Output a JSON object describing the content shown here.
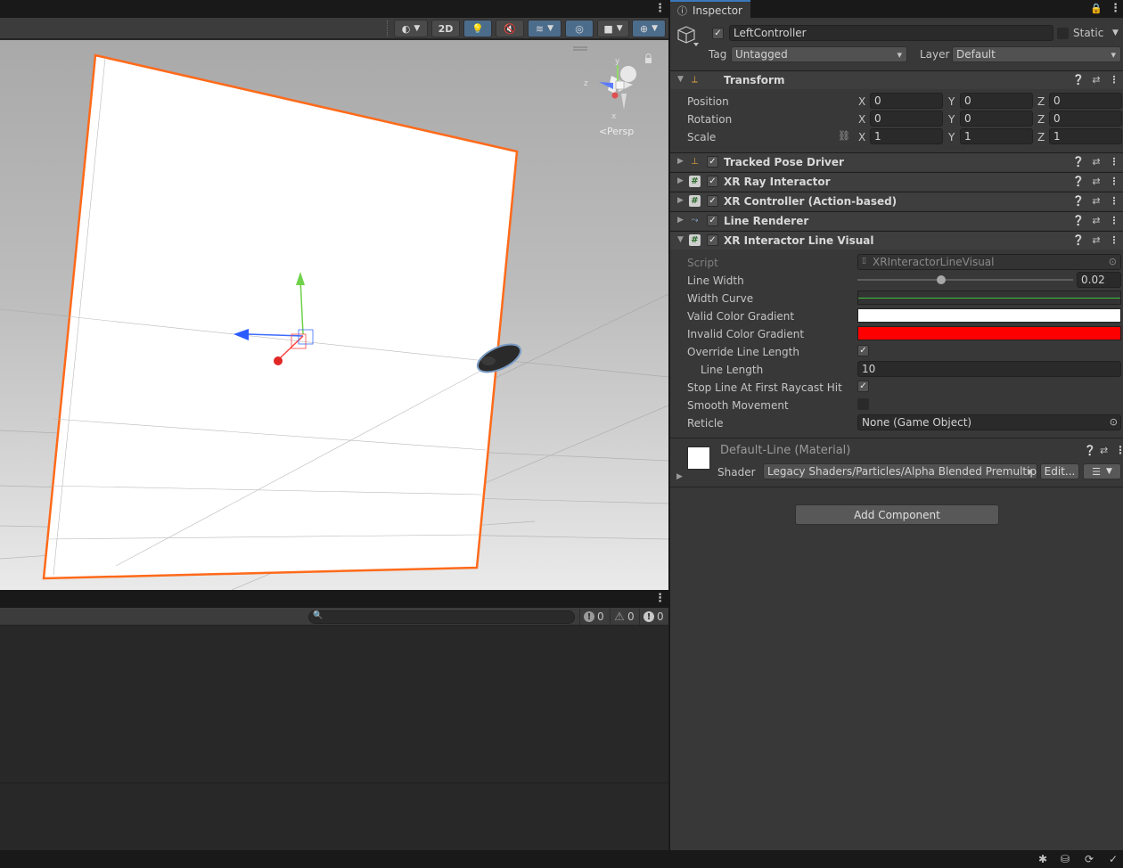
{
  "scene": {
    "toolbar": {
      "mode_2d": "2D",
      "persp_label": "Persp",
      "gizmo_axes": {
        "x": "x",
        "y": "y",
        "z": "z"
      }
    }
  },
  "console": {
    "search_placeholder": "",
    "counts": {
      "info": "0",
      "warning": "0",
      "error": "0"
    }
  },
  "inspector": {
    "tab_label": "Inspector",
    "object": {
      "name": "LeftController",
      "static_label": "Static",
      "tag_label": "Tag",
      "tag_value": "Untagged",
      "layer_label": "Layer",
      "layer_value": "Default"
    },
    "transform": {
      "title": "Transform",
      "rows": [
        {
          "label": "Position",
          "x": "0",
          "y": "0",
          "z": "0"
        },
        {
          "label": "Rotation",
          "x": "0",
          "y": "0",
          "z": "0"
        },
        {
          "label": "Scale",
          "x": "1",
          "y": "1",
          "z": "1"
        }
      ],
      "axis": {
        "x": "X",
        "y": "Y",
        "z": "Z"
      }
    },
    "components": {
      "tracked_pose_driver": "Tracked Pose Driver",
      "xr_ray_interactor": "XR Ray Interactor",
      "xr_controller": "XR Controller (Action-based)",
      "line_renderer": "Line Renderer",
      "xr_line_visual": "XR Interactor Line Visual"
    },
    "line_visual": {
      "script_label": "Script",
      "script_value": "XRInteractorLineVisual",
      "line_width_label": "Line Width",
      "line_width_value": "0.02",
      "line_width_fraction": 0.39,
      "width_curve_label": "Width Curve",
      "valid_color_label": "Valid Color Gradient",
      "valid_color": "#ffffff",
      "invalid_color_label": "Invalid Color Gradient",
      "invalid_color": "#ff0000",
      "override_label": "Override Line Length",
      "override_checked": true,
      "line_length_label": "Line Length",
      "line_length_value": "10",
      "stop_line_label": "Stop Line At First Raycast Hit",
      "stop_line_checked": true,
      "smooth_label": "Smooth Movement",
      "smooth_checked": false,
      "reticle_label": "Reticle",
      "reticle_value": "None (Game Object)"
    },
    "material": {
      "title": "Default-Line (Material)",
      "shader_label": "Shader",
      "shader_value": "Legacy Shaders/Particles/Alpha Blended Premultipl",
      "edit_label": "Edit..."
    },
    "add_component_label": "Add Component"
  },
  "colors": {
    "selection_outline": "#ff6a1a",
    "accent_blue": "#3a79bb",
    "toggle_on": "#4c6c8c"
  }
}
